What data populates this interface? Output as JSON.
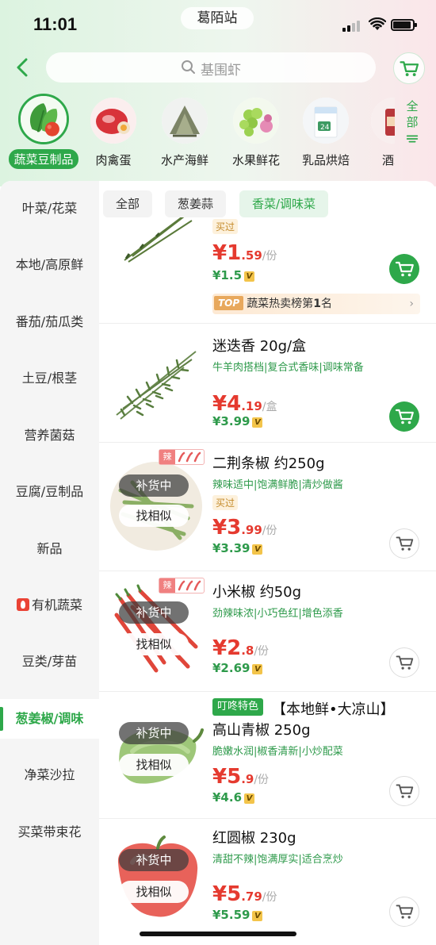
{
  "status_bar": {
    "time": "11:01",
    "station": "葛陌站"
  },
  "search": {
    "placeholder": "基围虾"
  },
  "categories": [
    {
      "label": "蔬菜豆制品",
      "icon": "vegetable-icon",
      "active": true
    },
    {
      "label": "肉禽蛋",
      "icon": "meat-icon"
    },
    {
      "label": "水产海鲜",
      "icon": "seafood-icon"
    },
    {
      "label": "水果鲜花",
      "icon": "fruit-icon"
    },
    {
      "label": "乳品烘焙",
      "icon": "dairy-icon"
    },
    {
      "label": "酒水",
      "icon": "drinks-icon"
    }
  ],
  "all_categories": {
    "line1": "全",
    "line2": "部"
  },
  "sidebar": [
    {
      "label": "叶菜/花菜"
    },
    {
      "label": "本地/高原鲜"
    },
    {
      "label": "番茄/茄瓜类"
    },
    {
      "label": "土豆/根茎"
    },
    {
      "label": "营养菌菇"
    },
    {
      "label": "豆腐/豆制品"
    },
    {
      "label": "新品"
    },
    {
      "label": "有机蔬菜"
    },
    {
      "label": "豆类/芽苗"
    },
    {
      "label": "葱姜椒/调味",
      "active": true
    },
    {
      "label": "净菜沙拉"
    },
    {
      "label": "买菜带束花"
    }
  ],
  "filters": [
    {
      "label": "全部"
    },
    {
      "label": "葱姜蒜"
    },
    {
      "label": "香菜/调味菜",
      "active": true
    }
  ],
  "products": [
    {
      "bought": "买过",
      "price_int": "¥1",
      "price_dec": ".59",
      "unit": "/份",
      "member_price": "¥1.5",
      "rank_prefix": "TOP",
      "rank_text": "蔬菜热卖榜第",
      "rank_num": "1",
      "rank_suffix": "名"
    },
    {
      "name": "迷迭香 20g/盒",
      "desc": "牛羊肉搭档|复合式香味|调味常备",
      "price_int": "¥4",
      "price_dec": ".19",
      "unit": "/盒",
      "member_price": "¥3.99"
    },
    {
      "name": "二荆条椒 约250g",
      "desc": "辣味适中|饱满鲜脆|清炒做酱",
      "bought": "买过",
      "spicy": "辣",
      "restock": "补货中",
      "similar": "找相似",
      "price_int": "¥3",
      "price_dec": ".99",
      "unit": "/份",
      "member_price": "¥3.39"
    },
    {
      "name": "小米椒 约50g",
      "desc": "劲辣味浓|小巧色红|增色添香",
      "spicy": "辣",
      "restock": "补货中",
      "similar": "找相似",
      "price_int": "¥2",
      "price_dec": ".8",
      "unit": "/份",
      "member_price": "¥2.69"
    },
    {
      "feature": "叮咚特色",
      "name_line1": "【本地鲜•大凉山】",
      "name_line2": "高山青椒 250g",
      "desc": "脆嫩水润|椒香清新|小炒配菜",
      "restock": "补货中",
      "similar": "找相似",
      "price_int": "¥5",
      "price_dec": ".9",
      "unit": "/份",
      "member_price": "¥4.6"
    },
    {
      "name": "红圆椒 230g",
      "desc": "清甜不辣|饱满厚实|适合烹炒",
      "restock": "补货中",
      "similar": "找相似",
      "price_int": "¥5",
      "price_dec": ".79",
      "unit": "/份",
      "member_price": "¥5.59"
    }
  ],
  "member_badge": "V",
  "colors": {
    "accent": "#2ea84a",
    "price": "#e53a2f"
  }
}
